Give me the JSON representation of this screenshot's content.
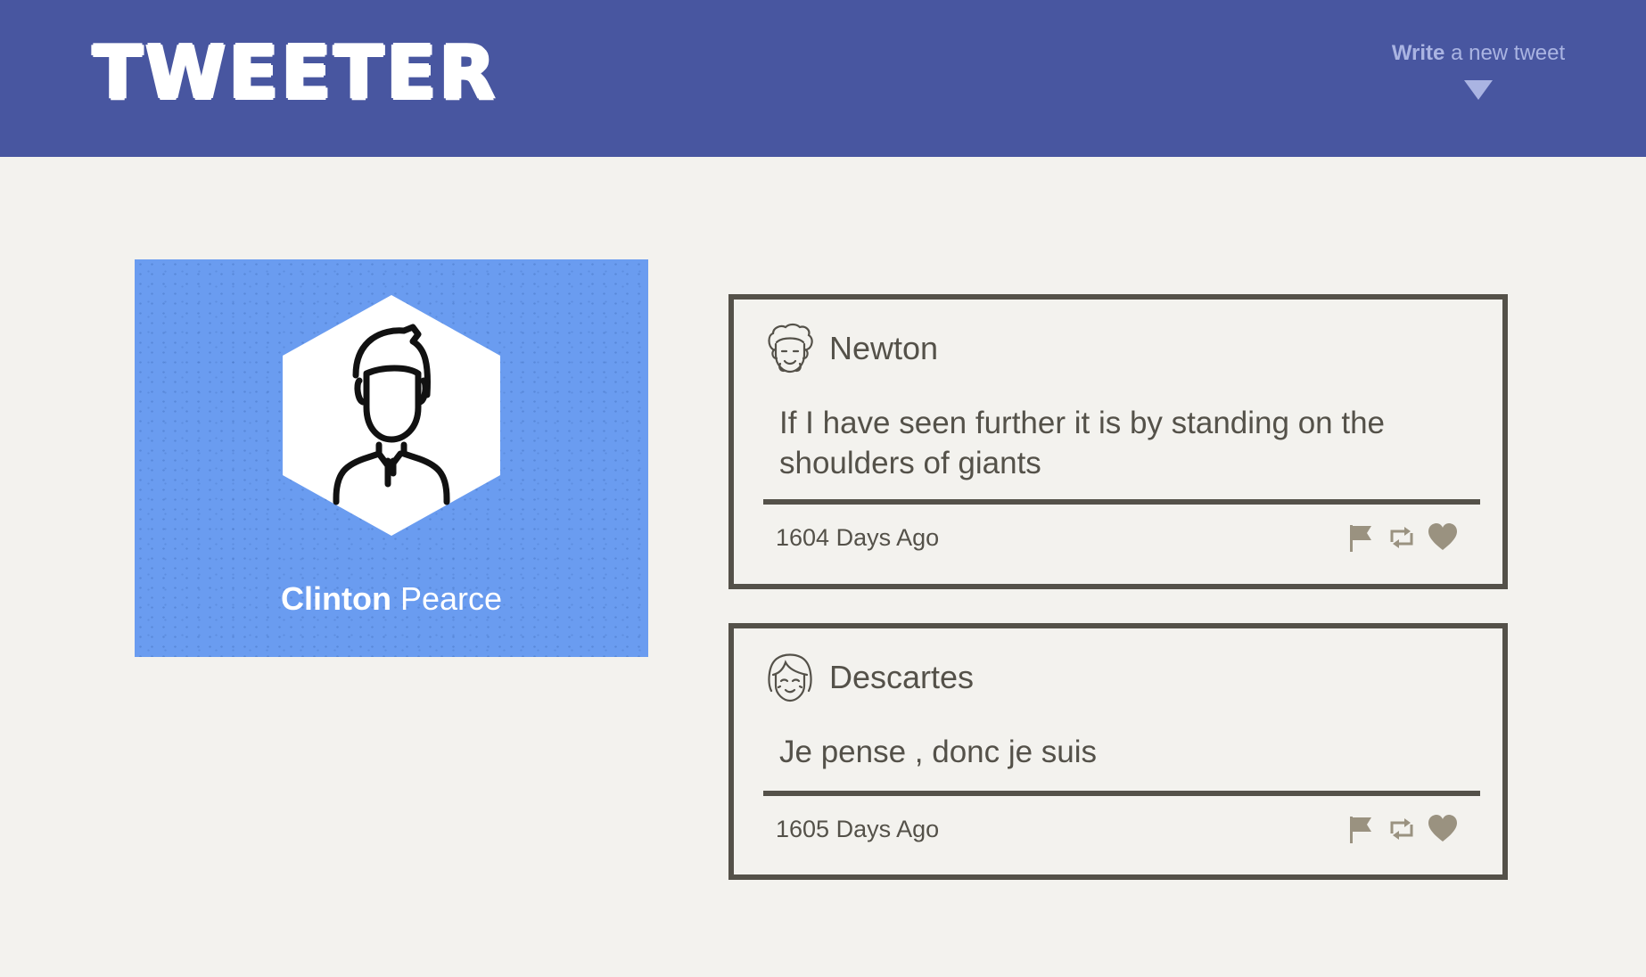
{
  "header": {
    "logo": "TWEETER",
    "compose_bold": "Write",
    "compose_rest": " a new tweet"
  },
  "profile": {
    "first_name": "Clinton",
    "last_name": " Pearce"
  },
  "tweets": [
    {
      "author": "Newton",
      "avatar_icon": "curly-hair-face-icon",
      "body": "If I have seen further it is by standing on the shoulders of giants",
      "time": "1604 Days Ago"
    },
    {
      "author": "Descartes",
      "avatar_icon": "bob-hair-face-icon",
      "body": "Je pense , donc je suis",
      "time": "1605 Days Ago"
    }
  ],
  "icons": {
    "flag": "flag-icon",
    "retweet": "retweet-icon",
    "like": "heart-icon"
  },
  "colors": {
    "header_bg": "#4856a0",
    "page_bg": "#f3f2ee",
    "profile_bg": "#6a9cf0",
    "text": "#545149",
    "action_icon": "#9a9280",
    "compose_text": "#aab4e2"
  }
}
